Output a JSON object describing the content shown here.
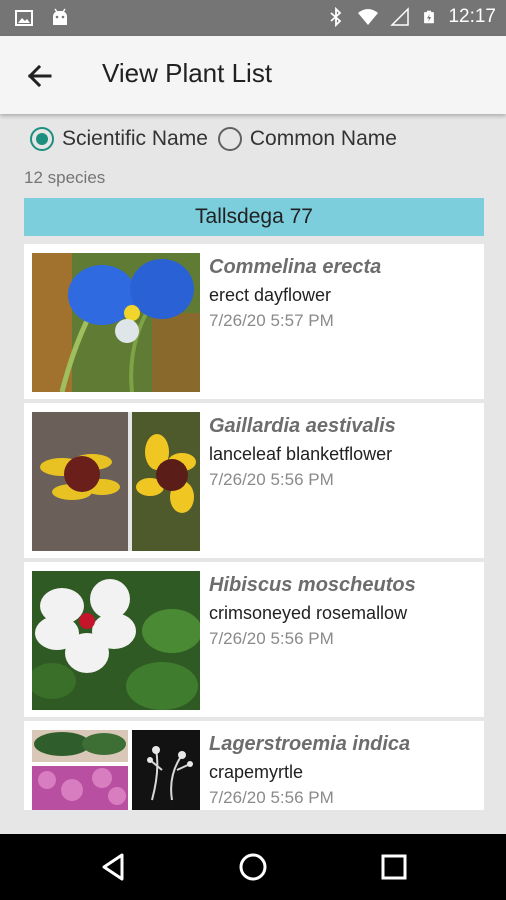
{
  "status_bar": {
    "time": "12:17",
    "left_icons": [
      "image-icon",
      "android-icon"
    ],
    "right_icons": [
      "bluetooth-icon",
      "wifi-icon",
      "signal-icon",
      "battery-icon"
    ]
  },
  "app_bar": {
    "title": "View Plant List",
    "back_icon": "arrow-back-icon"
  },
  "name_mode": {
    "options": [
      {
        "label": "Scientific Name",
        "selected": true
      },
      {
        "label": "Common Name",
        "selected": false
      }
    ]
  },
  "species_count": "12 species",
  "group_header": "Tallsdega 77",
  "plants": [
    {
      "scientific": "Commelina erecta",
      "common": "erect dayflower",
      "timestamp": "7/26/20 5:57 PM"
    },
    {
      "scientific": "Gaillardia aestivalis",
      "common": "lanceleaf blanketflower",
      "timestamp": "7/26/20 5:56 PM"
    },
    {
      "scientific": "Hibiscus moscheutos",
      "common": "crimsoneyed rosemallow",
      "timestamp": "7/26/20 5:56 PM"
    },
    {
      "scientific": "Lagerstroemia indica",
      "common": "crapemyrtle",
      "timestamp": "7/26/20 5:56 PM"
    }
  ],
  "nav_bar": {
    "icons": [
      "back-triangle-icon",
      "home-circle-icon",
      "recents-square-icon"
    ]
  },
  "colors": {
    "accent": "#1c8f7f",
    "group_header_bg": "#7ccedd",
    "status_bar": "#757575"
  }
}
